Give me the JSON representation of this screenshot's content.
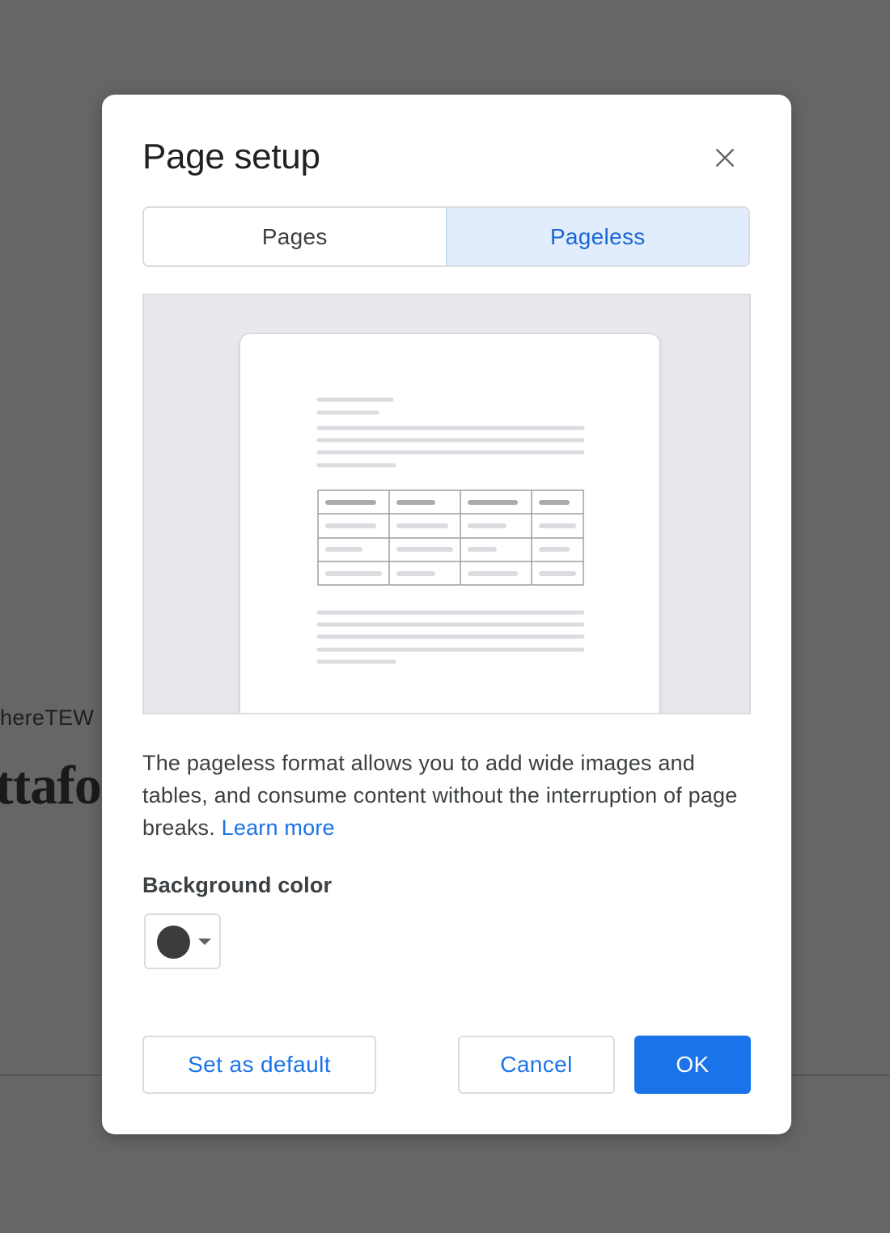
{
  "background": {
    "text_line_1": "hereTEW",
    "text_line_2": "ttafo"
  },
  "dialog": {
    "title": "Page setup",
    "close_icon": "close-icon",
    "tabs": [
      {
        "label": "Pages",
        "selected": false
      },
      {
        "label": "Pageless",
        "selected": true
      }
    ],
    "preview_icon": "pageless-document-illustration",
    "description": "The pageless format allows you to add wide images and tables, and consume content without the interruption of page breaks.",
    "learn_more": "Learn more",
    "background_color": {
      "label": "Background color",
      "value": "#3c3c3c",
      "dropdown_icon": "caret-down-icon"
    },
    "buttons": {
      "set_default": "Set as default",
      "cancel": "Cancel",
      "ok": "OK"
    }
  },
  "colors": {
    "accent": "#1a73e8",
    "tab_selected_bg": "#e1ecfd",
    "scrim": "#666666"
  }
}
